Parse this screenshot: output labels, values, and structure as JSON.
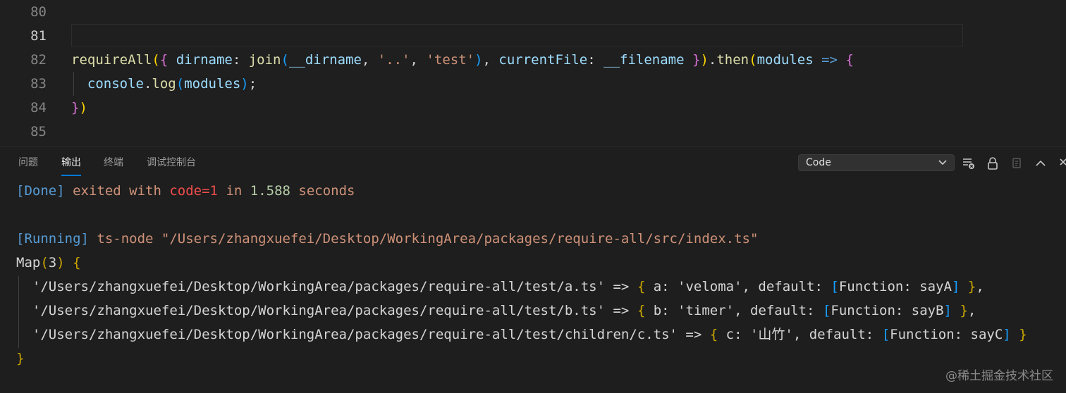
{
  "editor": {
    "lines": [
      {
        "n": "80",
        "segments": []
      },
      {
        "n": "81",
        "segments": []
      },
      {
        "n": "82",
        "segments": [
          {
            "t": "requireAll",
            "c": "yel"
          },
          {
            "t": "(",
            "c": "gold"
          },
          {
            "t": "{",
            "c": "pink"
          },
          {
            "t": " ",
            "c": "plain"
          },
          {
            "t": "dirname",
            "c": "blue"
          },
          {
            "t": ": ",
            "c": "plain"
          },
          {
            "t": "join",
            "c": "yel"
          },
          {
            "t": "(",
            "c": "sky"
          },
          {
            "t": "__dirname",
            "c": "blue"
          },
          {
            "t": ", ",
            "c": "plain"
          },
          {
            "t": "'..'",
            "c": "str"
          },
          {
            "t": ", ",
            "c": "plain"
          },
          {
            "t": "'test'",
            "c": "str"
          },
          {
            "t": ")",
            "c": "sky"
          },
          {
            "t": ", ",
            "c": "plain"
          },
          {
            "t": "currentFile",
            "c": "blue"
          },
          {
            "t": ": ",
            "c": "plain"
          },
          {
            "t": "__filename",
            "c": "blue"
          },
          {
            "t": " ",
            "c": "plain"
          },
          {
            "t": "}",
            "c": "pink"
          },
          {
            "t": ")",
            "c": "gold"
          },
          {
            "t": ".",
            "c": "plain"
          },
          {
            "t": "then",
            "c": "yel"
          },
          {
            "t": "(",
            "c": "gold"
          },
          {
            "t": "modules",
            "c": "blue"
          },
          {
            "t": " ",
            "c": "plain"
          },
          {
            "t": "=>",
            "c": "kw"
          },
          {
            "t": " ",
            "c": "plain"
          },
          {
            "t": "{",
            "c": "pink"
          }
        ]
      },
      {
        "n": "83",
        "segments": [
          {
            "t": "  ",
            "c": "plain"
          },
          {
            "t": "console",
            "c": "blue"
          },
          {
            "t": ".",
            "c": "plain"
          },
          {
            "t": "log",
            "c": "yel"
          },
          {
            "t": "(",
            "c": "sky"
          },
          {
            "t": "modules",
            "c": "blue"
          },
          {
            "t": ")",
            "c": "sky"
          },
          {
            "t": ";",
            "c": "plain"
          }
        ]
      },
      {
        "n": "84",
        "segments": [
          {
            "t": "}",
            "c": "pink"
          },
          {
            "t": ")",
            "c": "gold"
          }
        ]
      },
      {
        "n": "85",
        "segments": []
      }
    ]
  },
  "panel": {
    "tabs": [
      "问题",
      "输出",
      "终端",
      "调试控制台"
    ],
    "active_tab": "输出",
    "output_channel": "Code"
  },
  "output": {
    "lines": [
      [
        {
          "t": "[Done]",
          "c": "tagc"
        },
        {
          "t": " exited with ",
          "c": "str"
        },
        {
          "t": "code=1",
          "c": "err"
        },
        {
          "t": " in ",
          "c": "str"
        },
        {
          "t": "1.588",
          "c": "num"
        },
        {
          "t": " seconds",
          "c": "str"
        }
      ],
      [],
      [
        {
          "t": "[Running]",
          "c": "tagc"
        },
        {
          "t": " ts-node \"/Users/zhangxuefei/Desktop/WorkingArea/packages/require-all/src/index.ts\"",
          "c": "str"
        }
      ],
      [
        {
          "t": "Map",
          "c": "plain"
        },
        {
          "t": "(",
          "c": "ob"
        },
        {
          "t": "3",
          "c": "plain"
        },
        {
          "t": ")",
          "c": "ob"
        },
        {
          "t": " ",
          "c": "plain"
        },
        {
          "t": "{",
          "c": "ob"
        }
      ],
      [
        {
          "t": "  '/Users/zhangxuefei/Desktop/WorkingArea/packages/require-all/test/a.ts' => ",
          "c": "plain"
        },
        {
          "t": "{",
          "c": "ob"
        },
        {
          "t": " a: 'veloma', default: ",
          "c": "plain"
        },
        {
          "t": "[",
          "c": "sky"
        },
        {
          "t": "Function: sayA",
          "c": "plain"
        },
        {
          "t": "]",
          "c": "sky"
        },
        {
          "t": " ",
          "c": "plain"
        },
        {
          "t": "}",
          "c": "ob"
        },
        {
          "t": ",",
          "c": "plain"
        }
      ],
      [
        {
          "t": "  '/Users/zhangxuefei/Desktop/WorkingArea/packages/require-all/test/b.ts' => ",
          "c": "plain"
        },
        {
          "t": "{",
          "c": "ob"
        },
        {
          "t": " b: 'timer', default: ",
          "c": "plain"
        },
        {
          "t": "[",
          "c": "sky"
        },
        {
          "t": "Function: sayB",
          "c": "plain"
        },
        {
          "t": "]",
          "c": "sky"
        },
        {
          "t": " ",
          "c": "plain"
        },
        {
          "t": "}",
          "c": "ob"
        },
        {
          "t": ",",
          "c": "plain"
        }
      ],
      [
        {
          "t": "  '/Users/zhangxuefei/Desktop/WorkingArea/packages/require-all/test/children/c.ts' => ",
          "c": "plain"
        },
        {
          "t": "{",
          "c": "ob"
        },
        {
          "t": " c: '山竹', default: ",
          "c": "plain"
        },
        {
          "t": "[",
          "c": "sky"
        },
        {
          "t": "Function: sayC",
          "c": "plain"
        },
        {
          "t": "]",
          "c": "sky"
        },
        {
          "t": " ",
          "c": "plain"
        },
        {
          "t": "}",
          "c": "ob"
        }
      ],
      [
        {
          "t": "}",
          "c": "ob"
        }
      ]
    ]
  },
  "watermark": "@稀土掘金技术社区",
  "icons": [
    "clear-output-icon",
    "lock-icon",
    "copy-icon",
    "chevron-up-icon",
    "close-icon",
    "chevron-down-icon"
  ]
}
